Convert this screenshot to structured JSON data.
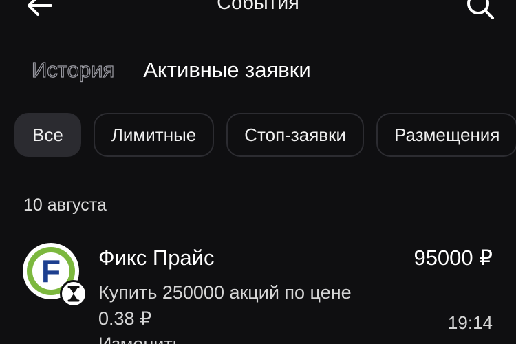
{
  "header": {
    "title": "События",
    "back_icon": "arrow-left-icon",
    "search_icon": "search-icon"
  },
  "tabs": [
    {
      "label": "История",
      "active": false
    },
    {
      "label": "Активные заявки",
      "active": true
    }
  ],
  "filters": [
    {
      "label": "Все",
      "selected": true
    },
    {
      "label": "Лимитные",
      "selected": false
    },
    {
      "label": "Стоп-заявки",
      "selected": false
    },
    {
      "label": "Размещения",
      "selected": false
    }
  ],
  "orders_section": {
    "date": "10 августа",
    "items": [
      {
        "name": "Фикс Прайс",
        "amount": "95000 ₽",
        "description": "Купить 250000 акций по цене 0.38 ₽",
        "time": "19:14",
        "action": "Изменить",
        "logo_letter": "F",
        "status_icon": "hourglass-icon"
      }
    ]
  },
  "colors": {
    "background": "#0f0f11",
    "chip_selected": "#2b2b30",
    "chip_border": "#2c2c31",
    "logo_green": "#7cb83e",
    "logo_blue": "#1d3f8f"
  }
}
